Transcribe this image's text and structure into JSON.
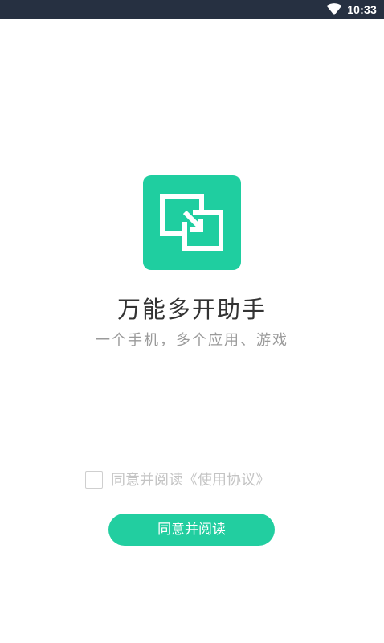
{
  "status_bar": {
    "time": "10:33",
    "icons": [
      "wifi-icon"
    ]
  },
  "app": {
    "logo_icon": "dual-window-icon",
    "name": "万能多开助手",
    "tagline": "一个手机，多个应用、游戏"
  },
  "agreement": {
    "checked": false,
    "label": "同意并阅读《使用协议》"
  },
  "primary_button": {
    "label": "同意并阅读"
  },
  "colors": {
    "status_bar_bg": "#263041",
    "accent": "#22cea0",
    "logo_bg": "#1fcea0",
    "title_text": "#333333",
    "subtitle_text": "#9a9a9a",
    "disabled_text": "#c4c4c4"
  }
}
